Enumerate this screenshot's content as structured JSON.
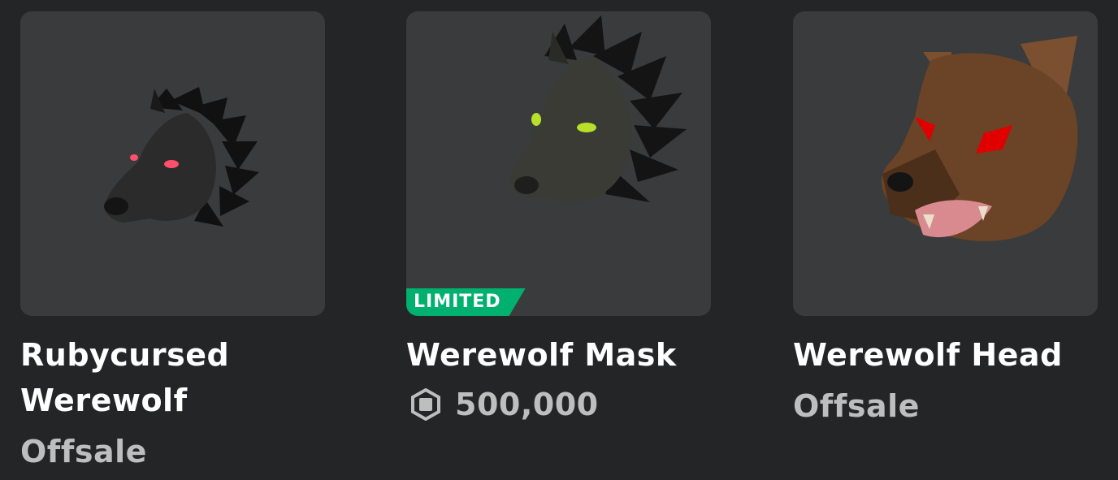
{
  "items": [
    {
      "name": "Rubycursed Werewolf",
      "status": "Offsale",
      "badge": "",
      "colors": {
        "fur": "#2a2a2a",
        "eyes": "#ff4f6a"
      }
    },
    {
      "name": "Werewolf Mask",
      "badge": "LIMITED",
      "price": "500,000",
      "price_icon": "robux-icon",
      "colors": {
        "fur": "#3a3b35",
        "eyes": "#b8e02a"
      }
    },
    {
      "name": "Werewolf Head",
      "status": "Offsale",
      "badge": "",
      "colors": {
        "fur": "#6b4326",
        "eyes": "#e00000"
      }
    }
  ],
  "theme": {
    "background": "#232527",
    "card_background": "#393b3d",
    "limited_badge": "#00b06f",
    "title_text": "#ffffff",
    "muted_text": "#bdbebe"
  }
}
